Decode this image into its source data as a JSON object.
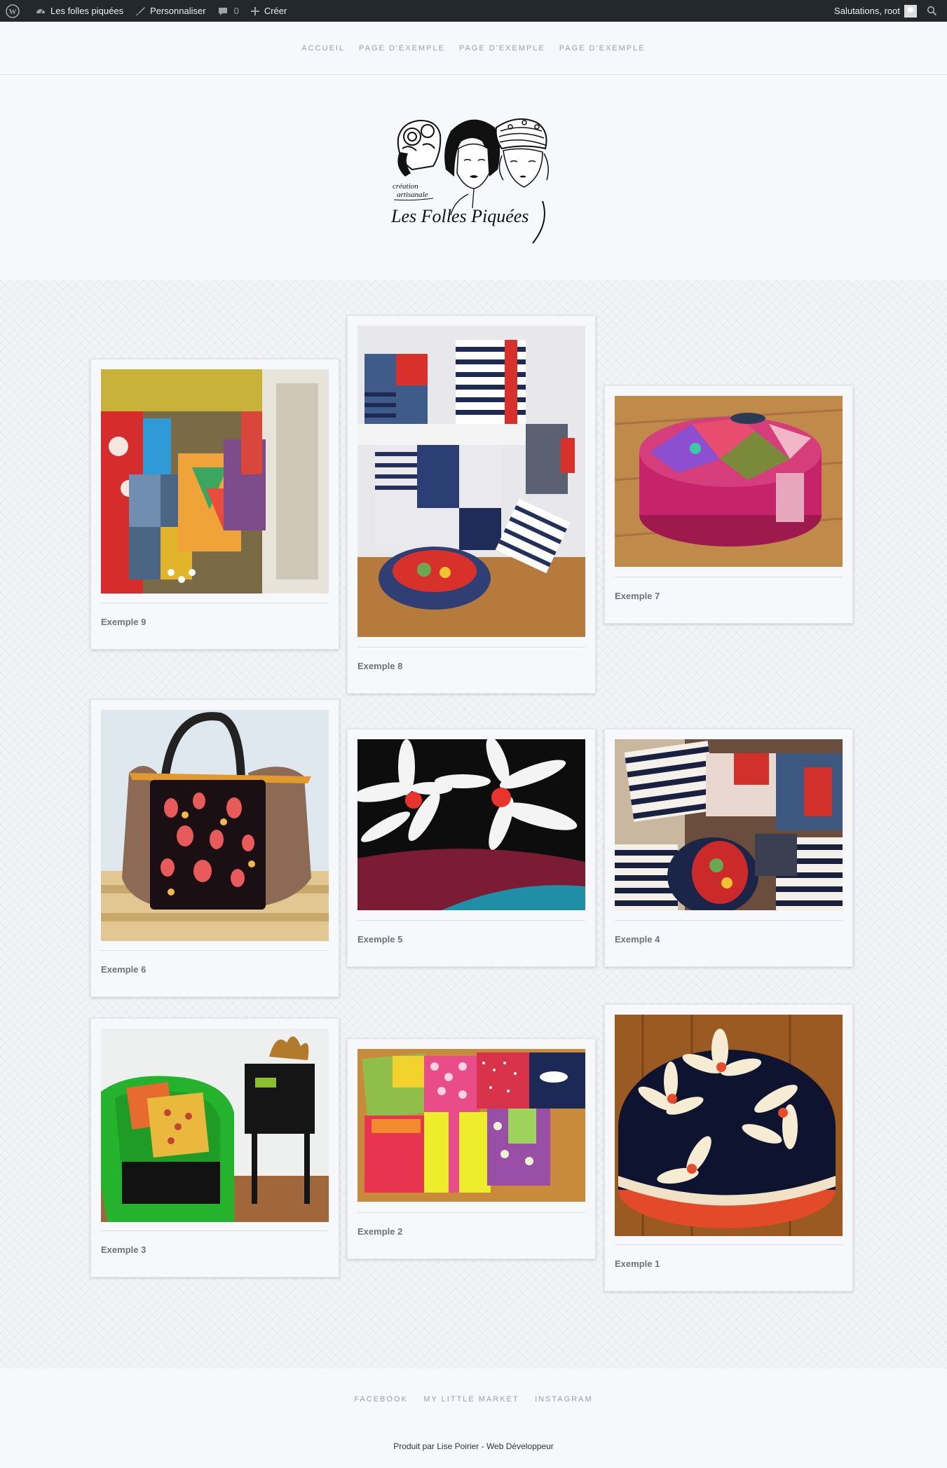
{
  "adminbar": {
    "site_name": "Les folles piquées",
    "customize": "Personnaliser",
    "comments_count": "0",
    "create": "Créer",
    "greeting": "Salutations, root"
  },
  "nav": {
    "items": [
      "ACCUEIL",
      "PAGE D'EXEMPLE",
      "PAGE D'EXEMPLE",
      "PAGE D'EXEMPLE"
    ]
  },
  "logo": {
    "alt_text_lines": [
      "création",
      "artisanale",
      "Les Folles Piquées"
    ]
  },
  "gallery": {
    "items": [
      {
        "caption": "Exemple 9",
        "subject": "bags-in-shop"
      },
      {
        "caption": "Exemple 8",
        "subject": "striped-cushions"
      },
      {
        "caption": "Exemple 7",
        "subject": "pink-pouf"
      },
      {
        "caption": "Exemple 6",
        "subject": "dotted-bag"
      },
      {
        "caption": "Exemple 5",
        "subject": "daisy-fabric"
      },
      {
        "caption": "Exemple 4",
        "subject": "cushions-stack"
      },
      {
        "caption": "Exemple 3",
        "subject": "green-chair"
      },
      {
        "caption": "Exemple 2",
        "subject": "colorful-cushions"
      },
      {
        "caption": "Exemple 1",
        "subject": "flower-pouf"
      }
    ]
  },
  "footer": {
    "links": [
      "FACEBOOK",
      "MY LITTLE MARKET",
      "INSTAGRAM"
    ],
    "credit": "Produit par Lise Poirier - Web Développeur"
  },
  "colors": {
    "adminbar_bg": "#23282d",
    "page_bg": "#f7f8fc",
    "caption": "#6f7279"
  }
}
